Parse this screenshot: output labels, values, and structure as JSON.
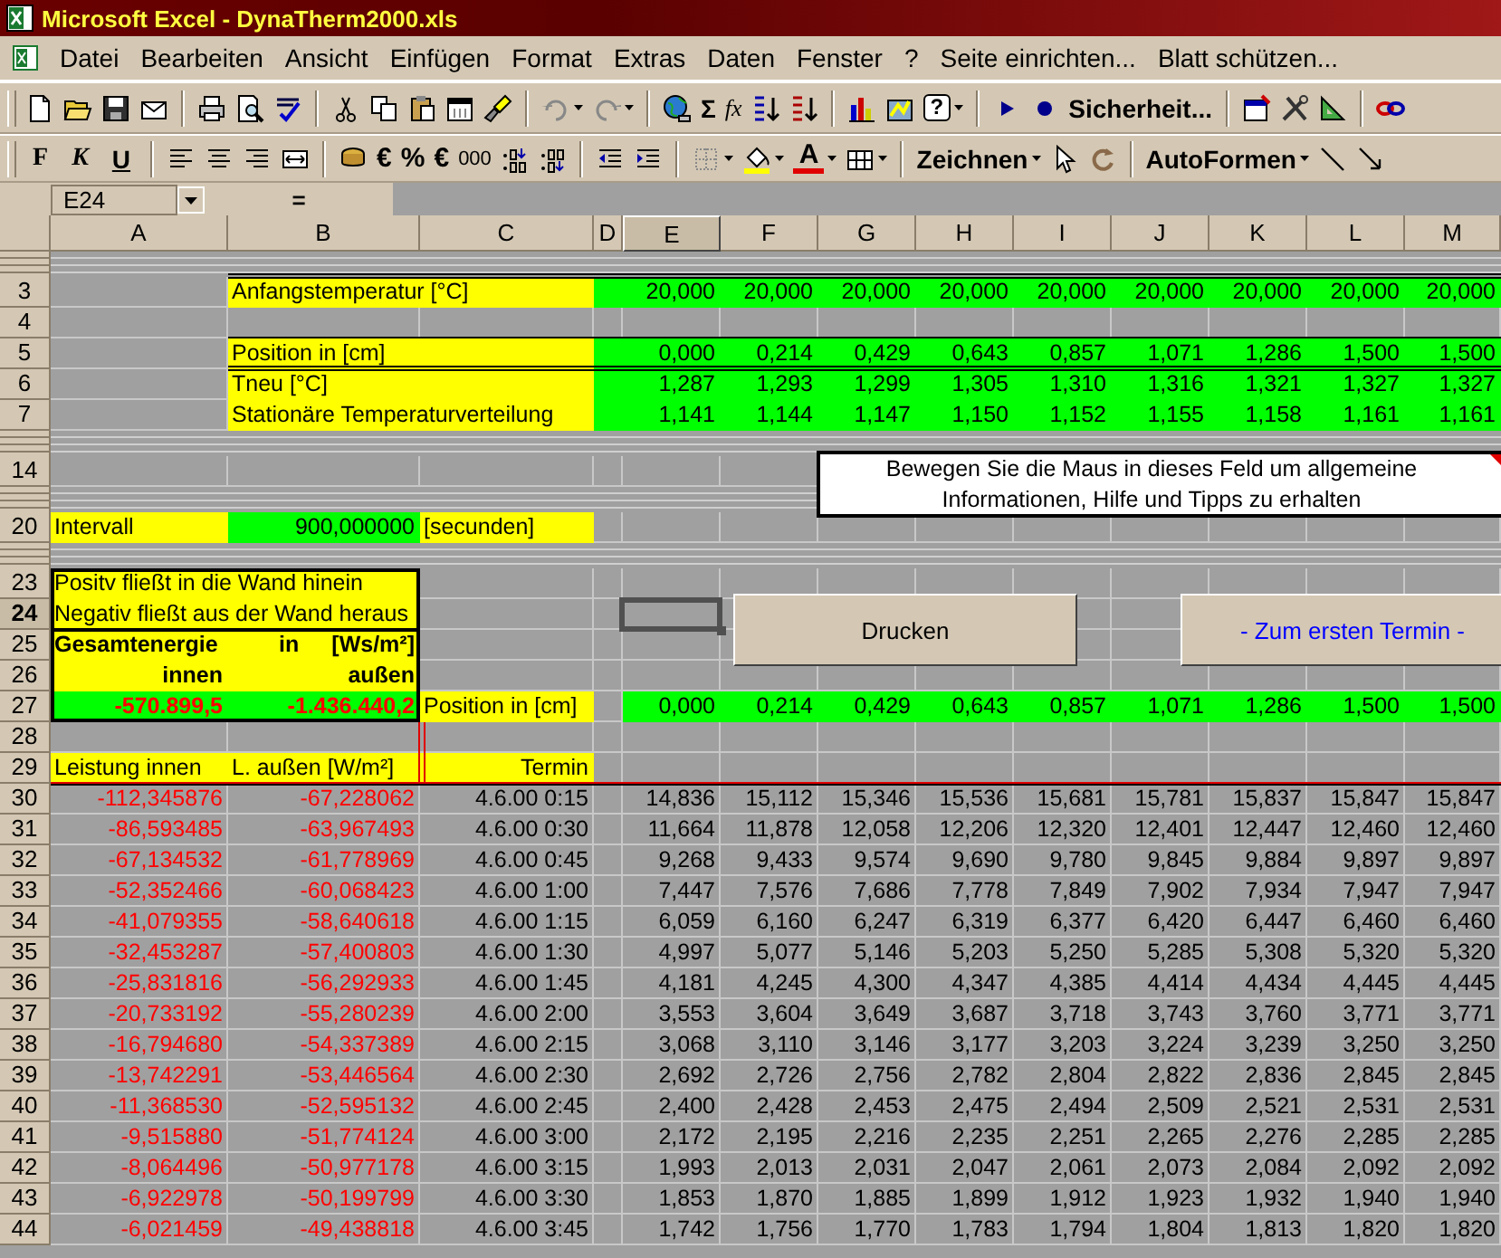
{
  "window": {
    "title": "Microsoft Excel - DynaTherm2000.xls"
  },
  "menu": [
    {
      "label": "Datei"
    },
    {
      "label": "Bearbeiten"
    },
    {
      "label": "Ansicht"
    },
    {
      "label": "Einfügen"
    },
    {
      "label": "Format"
    },
    {
      "label": "Extras"
    },
    {
      "label": "Daten"
    },
    {
      "label": "Fenster"
    },
    {
      "label": "?"
    },
    {
      "label": "Seite einrichten..."
    },
    {
      "label": "Blatt schützen..."
    }
  ],
  "standard_toolbar": {
    "sum": "Σ",
    "function": "fx",
    "help": "?",
    "security": "Sicherheit..."
  },
  "formatting_toolbar": {
    "bold": "F",
    "italic": "K",
    "underline": "U",
    "euro": "€",
    "percent": "%",
    "euro_alt": "€",
    "thousands": "000",
    "font_color": "A",
    "drawing": "Zeichnen",
    "autoshapes": "AutoFormen"
  },
  "formula_bar": {
    "name_box": "E24",
    "equals": "="
  },
  "columns": [
    {
      "label": "A",
      "selected": false
    },
    {
      "label": "B",
      "selected": false
    },
    {
      "label": "C",
      "selected": false
    },
    {
      "label": "D",
      "selected": false
    },
    {
      "label": "E",
      "selected": true
    },
    {
      "label": "F",
      "selected": false
    },
    {
      "label": "G",
      "selected": false
    },
    {
      "label": "H",
      "selected": false
    },
    {
      "label": "I",
      "selected": false
    },
    {
      "label": "J",
      "selected": false
    },
    {
      "label": "K",
      "selected": false
    },
    {
      "label": "L",
      "selected": false
    },
    {
      "label": "M",
      "selected": false
    }
  ],
  "rows": [
    {
      "kind": "collapsed"
    },
    {
      "kind": "row",
      "number": "3",
      "selected": false,
      "cells": [
        {
          "kind": "empty"
        },
        {
          "text": "Anfangstemperatur [°C]",
          "color": "#ffff00",
          "kind": "text"
        },
        {
          "kind": "empty",
          "color": "#ffff00"
        },
        {
          "kind": "empty",
          "color": "#00ff00"
        },
        {
          "text": "20,000",
          "color": "#00ff00",
          "kind": "number"
        },
        {
          "text": "20,000",
          "color": "#00ff00",
          "kind": "number"
        },
        {
          "text": "20,000",
          "color": "#00ff00",
          "kind": "number"
        },
        {
          "text": "20,000",
          "color": "#00ff00",
          "kind": "number"
        },
        {
          "text": "20,000",
          "color": "#00ff00",
          "kind": "number"
        },
        {
          "text": "20,000",
          "color": "#00ff00",
          "kind": "number"
        },
        {
          "text": "20,000",
          "color": "#00ff00",
          "kind": "number"
        },
        {
          "text": "20,000",
          "color": "#00ff00",
          "kind": "number"
        },
        {
          "text": "20,000",
          "color": "#00ff00",
          "kind": "number"
        }
      ]
    },
    {
      "kind": "row",
      "number": "4",
      "selected": false
    },
    {
      "kind": "row",
      "number": "5",
      "selected": false,
      "cells": [
        {
          "kind": "empty"
        },
        {
          "text": "Position in [cm]",
          "color": "#ffff00",
          "kind": "text"
        },
        {
          "kind": "empty",
          "color": "#ffff00"
        },
        {
          "kind": "empty",
          "color": "#00ff00"
        },
        {
          "text": "0,000",
          "color": "#00ff00",
          "kind": "number"
        },
        {
          "text": "0,214",
          "color": "#00ff00",
          "kind": "number"
        },
        {
          "text": "0,429",
          "color": "#00ff00",
          "kind": "number"
        },
        {
          "text": "0,643",
          "color": "#00ff00",
          "kind": "number"
        },
        {
          "text": "0,857",
          "color": "#00ff00",
          "kind": "number"
        },
        {
          "text": "1,071",
          "color": "#00ff00",
          "kind": "number"
        },
        {
          "text": "1,286",
          "color": "#00ff00",
          "kind": "number"
        },
        {
          "text": "1,500",
          "color": "#00ff00",
          "kind": "number"
        },
        {
          "text": "1,500",
          "color": "#00ff00",
          "kind": "number"
        }
      ]
    },
    {
      "kind": "row",
      "number": "6",
      "selected": false,
      "cells": [
        {
          "kind": "empty"
        },
        {
          "text": "Tneu [°C]",
          "color": "#ffff00",
          "kind": "text"
        },
        {
          "kind": "empty",
          "color": "#ffff00"
        },
        {
          "kind": "empty",
          "color": "#00ff00"
        },
        {
          "text": "1,287",
          "color": "#00ff00",
          "kind": "number"
        },
        {
          "text": "1,293",
          "color": "#00ff00",
          "kind": "number"
        },
        {
          "text": "1,299",
          "color": "#00ff00",
          "kind": "number"
        },
        {
          "text": "1,305",
          "color": "#00ff00",
          "kind": "number"
        },
        {
          "text": "1,310",
          "color": "#00ff00",
          "kind": "number"
        },
        {
          "text": "1,316",
          "color": "#00ff00",
          "kind": "number"
        },
        {
          "text": "1,321",
          "color": "#00ff00",
          "kind": "number"
        },
        {
          "text": "1,327",
          "color": "#00ff00",
          "kind": "number"
        },
        {
          "text": "1,327",
          "color": "#00ff00",
          "kind": "number"
        }
      ]
    },
    {
      "kind": "row",
      "number": "7",
      "selected": false,
      "cells": [
        {
          "kind": "empty"
        },
        {
          "text": "Stationäre Temperaturverteilung",
          "color": "#ffff00",
          "kind": "text"
        },
        {
          "kind": "empty",
          "color": "#ffff00"
        },
        {
          "kind": "empty",
          "color": "#00ff00"
        },
        {
          "text": "1,141",
          "color": "#00ff00",
          "kind": "number"
        },
        {
          "text": "1,144",
          "color": "#00ff00",
          "kind": "number"
        },
        {
          "text": "1,147",
          "color": "#00ff00",
          "kind": "number"
        },
        {
          "text": "1,150",
          "color": "#00ff00",
          "kind": "number"
        },
        {
          "text": "1,152",
          "color": "#00ff00",
          "kind": "number"
        },
        {
          "text": "1,155",
          "color": "#00ff00",
          "kind": "number"
        },
        {
          "text": "1,158",
          "color": "#00ff00",
          "kind": "number"
        },
        {
          "text": "1,161",
          "color": "#00ff00",
          "kind": "number"
        },
        {
          "text": "1,161",
          "color": "#00ff00",
          "kind": "number"
        }
      ]
    },
    {
      "kind": "collapsed"
    },
    {
      "kind": "row",
      "number": "14",
      "selected": false
    },
    {
      "kind": "collapsed"
    },
    {
      "kind": "row",
      "number": "20",
      "selected": false,
      "cells": [
        {
          "text": "Intervall",
          "color": "#ffff00",
          "kind": "text"
        },
        {
          "text": "900,000000",
          "color": "#00ff00",
          "kind": "number"
        },
        {
          "text": "[secunden]",
          "color": "#ffff00",
          "kind": "text"
        }
      ]
    },
    {
      "kind": "collapsed"
    },
    {
      "kind": "row",
      "number": "23",
      "selected": false,
      "cells": [
        {
          "text": "Positv fließt in die Wand hinein",
          "color": "#ffff00",
          "kind": "text"
        },
        {
          "kind": "empty",
          "color": "#ffff00"
        }
      ]
    },
    {
      "kind": "row",
      "number": "24",
      "selected": true,
      "cells": [
        {
          "text": "Negativ fließt aus der Wand heraus",
          "color": "#ffff00",
          "kind": "text"
        },
        {
          "kind": "empty",
          "color": "#ffff00"
        }
      ]
    },
    {
      "kind": "row",
      "number": "25",
      "selected": false,
      "cells": [
        {
          "text": "Gesamtenergie",
          "color": "#ffff00",
          "kind": "bold"
        },
        {
          "parts": [
            "in",
            "[Ws/m²]"
          ],
          "color": "#ffff00",
          "kind": "bold"
        }
      ]
    },
    {
      "kind": "row",
      "number": "26",
      "selected": false,
      "cells": [
        {
          "text": "innen",
          "color": "#ffff00",
          "kind": "bold-right"
        },
        {
          "text": "außen",
          "color": "#ffff00",
          "kind": "bold-right"
        }
      ]
    },
    {
      "kind": "row",
      "number": "27",
      "selected": false,
      "cells": [
        {
          "text": "-570.899,5",
          "color": "#00ff00",
          "kind": "negative-bold"
        },
        {
          "text": "-1.436.440,2",
          "color": "#00ff00",
          "kind": "negative-bold"
        },
        {
          "text": "Position in [cm]",
          "color": "#ffff00",
          "kind": "text"
        },
        {
          "kind": "empty"
        },
        {
          "text": "0,000",
          "color": "#00ff00",
          "kind": "number"
        },
        {
          "text": "0,214",
          "color": "#00ff00",
          "kind": "number"
        },
        {
          "text": "0,429",
          "color": "#00ff00",
          "kind": "number"
        },
        {
          "text": "0,643",
          "color": "#00ff00",
          "kind": "number"
        },
        {
          "text": "0,857",
          "color": "#00ff00",
          "kind": "number"
        },
        {
          "text": "1,071",
          "color": "#00ff00",
          "kind": "number"
        },
        {
          "text": "1,286",
          "color": "#00ff00",
          "kind": "number"
        },
        {
          "text": "1,500",
          "color": "#00ff00",
          "kind": "number"
        },
        {
          "text": "1,500",
          "color": "#00ff00",
          "kind": "number"
        }
      ]
    },
    {
      "kind": "row",
      "number": "28",
      "selected": false
    },
    {
      "kind": "row",
      "number": "29",
      "selected": false,
      "cells": [
        {
          "text": "Leistung innen",
          "color": "#ffff00",
          "kind": "text"
        },
        {
          "text": "L. außen [W/m²]",
          "color": "#ffff00",
          "kind": "text"
        },
        {
          "text": "Termin",
          "color": "#ffff00",
          "kind": "right"
        }
      ]
    }
  ],
  "data_rows": [
    {
      "number": "30",
      "inner": "-112,345876",
      "outer": "-67,228062",
      "termin": "4.6.00 0:15",
      "values": [
        "14,836",
        "15,112",
        "15,346",
        "15,536",
        "15,681",
        "15,781",
        "15,837",
        "15,847",
        "15,847"
      ]
    },
    {
      "number": "31",
      "inner": "-86,593485",
      "outer": "-63,967493",
      "termin": "4.6.00 0:30",
      "values": [
        "11,664",
        "11,878",
        "12,058",
        "12,206",
        "12,320",
        "12,401",
        "12,447",
        "12,460",
        "12,460"
      ]
    },
    {
      "number": "32",
      "inner": "-67,134532",
      "outer": "-61,778969",
      "termin": "4.6.00 0:45",
      "values": [
        "9,268",
        "9,433",
        "9,574",
        "9,690",
        "9,780",
        "9,845",
        "9,884",
        "9,897",
        "9,897"
      ]
    },
    {
      "number": "33",
      "inner": "-52,352466",
      "outer": "-60,068423",
      "termin": "4.6.00 1:00",
      "values": [
        "7,447",
        "7,576",
        "7,686",
        "7,778",
        "7,849",
        "7,902",
        "7,934",
        "7,947",
        "7,947"
      ]
    },
    {
      "number": "34",
      "inner": "-41,079355",
      "outer": "-58,640618",
      "termin": "4.6.00 1:15",
      "values": [
        "6,059",
        "6,160",
        "6,247",
        "6,319",
        "6,377",
        "6,420",
        "6,447",
        "6,460",
        "6,460"
      ]
    },
    {
      "number": "35",
      "inner": "-32,453287",
      "outer": "-57,400803",
      "termin": "4.6.00 1:30",
      "values": [
        "4,997",
        "5,077",
        "5,146",
        "5,203",
        "5,250",
        "5,285",
        "5,308",
        "5,320",
        "5,320"
      ]
    },
    {
      "number": "36",
      "inner": "-25,831816",
      "outer": "-56,292933",
      "termin": "4.6.00 1:45",
      "values": [
        "4,181",
        "4,245",
        "4,300",
        "4,347",
        "4,385",
        "4,414",
        "4,434",
        "4,445",
        "4,445"
      ]
    },
    {
      "number": "37",
      "inner": "-20,733192",
      "outer": "-55,280239",
      "termin": "4.6.00 2:00",
      "values": [
        "3,553",
        "3,604",
        "3,649",
        "3,687",
        "3,718",
        "3,743",
        "3,760",
        "3,771",
        "3,771"
      ]
    },
    {
      "number": "38",
      "inner": "-16,794680",
      "outer": "-54,337389",
      "termin": "4.6.00 2:15",
      "values": [
        "3,068",
        "3,110",
        "3,146",
        "3,177",
        "3,203",
        "3,224",
        "3,239",
        "3,250",
        "3,250"
      ]
    },
    {
      "number": "39",
      "inner": "-13,742291",
      "outer": "-53,446564",
      "termin": "4.6.00 2:30",
      "values": [
        "2,692",
        "2,726",
        "2,756",
        "2,782",
        "2,804",
        "2,822",
        "2,836",
        "2,845",
        "2,845"
      ]
    },
    {
      "number": "40",
      "inner": "-11,368530",
      "outer": "-52,595132",
      "termin": "4.6.00 2:45",
      "values": [
        "2,400",
        "2,428",
        "2,453",
        "2,475",
        "2,494",
        "2,509",
        "2,521",
        "2,531",
        "2,531"
      ]
    },
    {
      "number": "41",
      "inner": "-9,515880",
      "outer": "-51,774124",
      "termin": "4.6.00 3:00",
      "values": [
        "2,172",
        "2,195",
        "2,216",
        "2,235",
        "2,251",
        "2,265",
        "2,276",
        "2,285",
        "2,285"
      ]
    },
    {
      "number": "42",
      "inner": "-8,064496",
      "outer": "-50,977178",
      "termin": "4.6.00 3:15",
      "values": [
        "1,993",
        "2,013",
        "2,031",
        "2,047",
        "2,061",
        "2,073",
        "2,084",
        "2,092",
        "2,092"
      ]
    },
    {
      "number": "43",
      "inner": "-6,922978",
      "outer": "-50,199799",
      "termin": "4.6.00 3:30",
      "values": [
        "1,853",
        "1,870",
        "1,885",
        "1,899",
        "1,912",
        "1,923",
        "1,932",
        "1,940",
        "1,940"
      ]
    },
    {
      "number": "44",
      "inner": "-6,021459",
      "outer": "-49,438818",
      "termin": "4.6.00 3:45",
      "values": [
        "1,742",
        "1,756",
        "1,770",
        "1,783",
        "1,794",
        "1,804",
        "1,813",
        "1,820",
        "1,820"
      ]
    }
  ],
  "comment": {
    "text": "Bewegen Sie die Maus in dieses Feld um allgemeine Informationen, Hilfe und Tipps zu erhalten"
  },
  "buttons": [
    {
      "label": "Drucken",
      "kind": "print"
    },
    {
      "label": "- Zum ersten Termin -",
      "kind": "link"
    }
  ]
}
